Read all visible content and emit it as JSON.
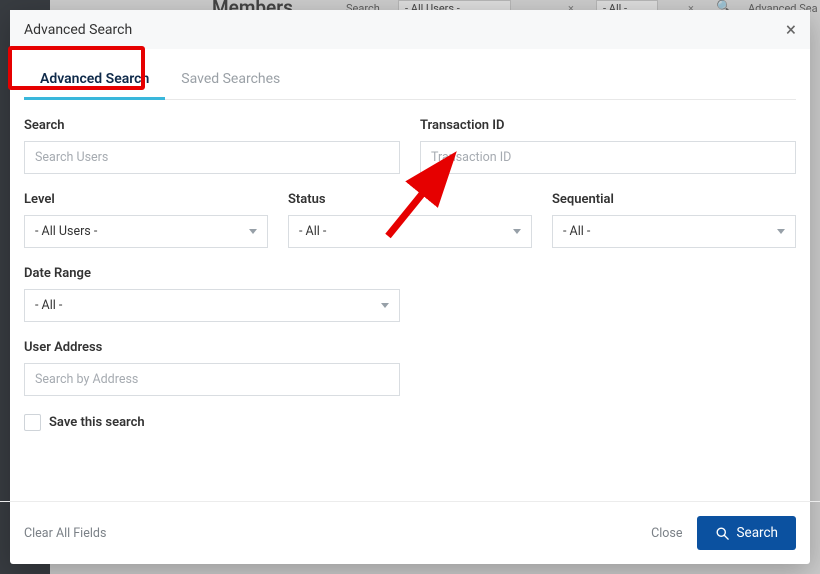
{
  "background": {
    "members_title": "Members",
    "search_label": "Search",
    "all_users": "- All Users -",
    "all": "- All -",
    "advanced": "Advanced Sea"
  },
  "modal": {
    "title": "Advanced Search",
    "tabs": {
      "advanced": "Advanced Search",
      "saved": "Saved Searches"
    },
    "fields": {
      "search": {
        "label": "Search",
        "placeholder": "Search Users",
        "value": ""
      },
      "transaction": {
        "label": "Transaction ID",
        "placeholder": "Transaction ID",
        "value": ""
      },
      "level": {
        "label": "Level",
        "value": "- All Users -"
      },
      "status": {
        "label": "Status",
        "value": "- All -"
      },
      "sequential": {
        "label": "Sequential",
        "value": "- All -"
      },
      "date_range": {
        "label": "Date Range",
        "value": "- All -"
      },
      "user_address": {
        "label": "User Address",
        "placeholder": "Search by Address",
        "value": ""
      }
    },
    "save_search": "Save this search",
    "footer": {
      "clear": "Clear All Fields",
      "close": "Close",
      "search": "Search"
    }
  }
}
